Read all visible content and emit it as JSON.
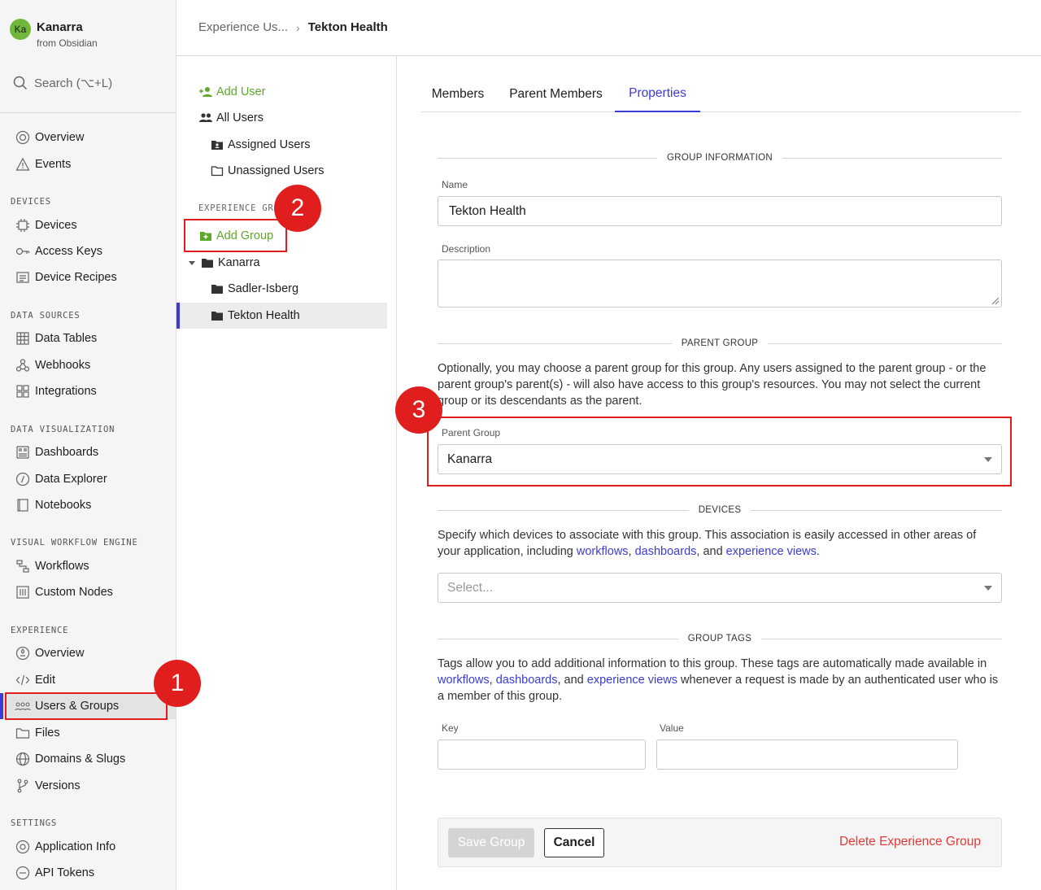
{
  "org": {
    "initials": "Ka",
    "name": "Kanarra",
    "from": "from Obsidian"
  },
  "search": {
    "label": "Search (⌥+L)"
  },
  "sidebar": {
    "top": [
      {
        "label": "Overview",
        "icon": "overview-icon"
      },
      {
        "label": "Events",
        "icon": "warning-icon"
      }
    ],
    "devices_label": "DEVICES",
    "devices": [
      {
        "label": "Devices",
        "icon": "chip-icon"
      },
      {
        "label": "Access Keys",
        "icon": "key-icon"
      },
      {
        "label": "Device Recipes",
        "icon": "recipe-icon"
      }
    ],
    "data_sources_label": "DATA SOURCES",
    "data_sources": [
      {
        "label": "Data Tables",
        "icon": "table-icon"
      },
      {
        "label": "Webhooks",
        "icon": "webhook-icon"
      },
      {
        "label": "Integrations",
        "icon": "integration-icon"
      }
    ],
    "data_viz_label": "DATA VISUALIZATION",
    "data_viz": [
      {
        "label": "Dashboards",
        "icon": "dashboard-icon"
      },
      {
        "label": "Data Explorer",
        "icon": "explorer-icon"
      },
      {
        "label": "Notebooks",
        "icon": "notebook-icon"
      }
    ],
    "workflow_label": "VISUAL WORKFLOW ENGINE",
    "workflow": [
      {
        "label": "Workflows",
        "icon": "workflow-icon"
      },
      {
        "label": "Custom Nodes",
        "icon": "custom-nodes-icon"
      }
    ],
    "experience_label": "EXPERIENCE",
    "experience": [
      {
        "label": "Overview",
        "icon": "experience-overview-icon"
      },
      {
        "label": "Edit",
        "icon": "code-icon"
      },
      {
        "label": "Users & Groups",
        "icon": "users-icon"
      },
      {
        "label": "Files",
        "icon": "folder-icon"
      },
      {
        "label": "Domains & Slugs",
        "icon": "globe-icon"
      },
      {
        "label": "Versions",
        "icon": "branch-icon"
      }
    ],
    "settings_label": "SETTINGS",
    "settings": [
      {
        "label": "Application Info",
        "icon": "gear-icon"
      },
      {
        "label": "API Tokens",
        "icon": "token-icon"
      }
    ]
  },
  "breadcrumb": {
    "parent": "Experience Us...",
    "sep": "›",
    "current": "Tekton Health"
  },
  "mid": {
    "add_user": "Add User",
    "all_users": "All Users",
    "assigned_users": "Assigned Users",
    "unassigned_users": "Unassigned Users",
    "groups_label": "EXPERIENCE GR",
    "add_group": "Add Group",
    "groups": [
      {
        "label": "Kanarra"
      },
      {
        "label": "Sadler-Isberg"
      },
      {
        "label": "Tekton Health"
      }
    ]
  },
  "tabs": {
    "members": "Members",
    "parent_members": "Parent Members",
    "properties": "Properties"
  },
  "form": {
    "group_info_head": "GROUP INFORMATION",
    "name_label": "Name",
    "name_value": "Tekton Health",
    "description_label": "Description",
    "description_value": "",
    "parent_group_head": "PARENT GROUP",
    "parent_group_help": "Optionally, you may choose a parent group for this group. Any users assigned to the parent group - or the parent group's parent(s) - will also have access to this group's resources. You may not select the current group or its descendants as the parent.",
    "parent_group_label": "Parent Group",
    "parent_group_value": "Kanarra",
    "devices_head": "DEVICES",
    "devices_help_1": "Specify which devices to associate with this group. This association is easily accessed in other areas of your application, including ",
    "link_workflows": "workflows",
    "comma": ",",
    "link_dashboards": "dashboards",
    "and": ", and",
    "link_experience_views": "experience views",
    "period": ".",
    "devices_placeholder": "Select...",
    "tags_head": "GROUP TAGS",
    "tags_help_1": "Tags allow you to add additional information to this group. These tags are automatically made available in ",
    "tags_help_2": " whenever a request is made by an authenticated user who is a member of this group.",
    "and_plain": ", and",
    "key_label": "Key",
    "value_label": "Value",
    "save": "Save Group",
    "cancel": "Cancel",
    "delete": "Delete Experience Group"
  },
  "annotations": {
    "one": "1",
    "two": "2",
    "three": "3",
    "color": "#e01e1e"
  },
  "colors": {
    "accent": "#3b3bd6",
    "green": "#5fa82c",
    "danger": "#e53935"
  }
}
